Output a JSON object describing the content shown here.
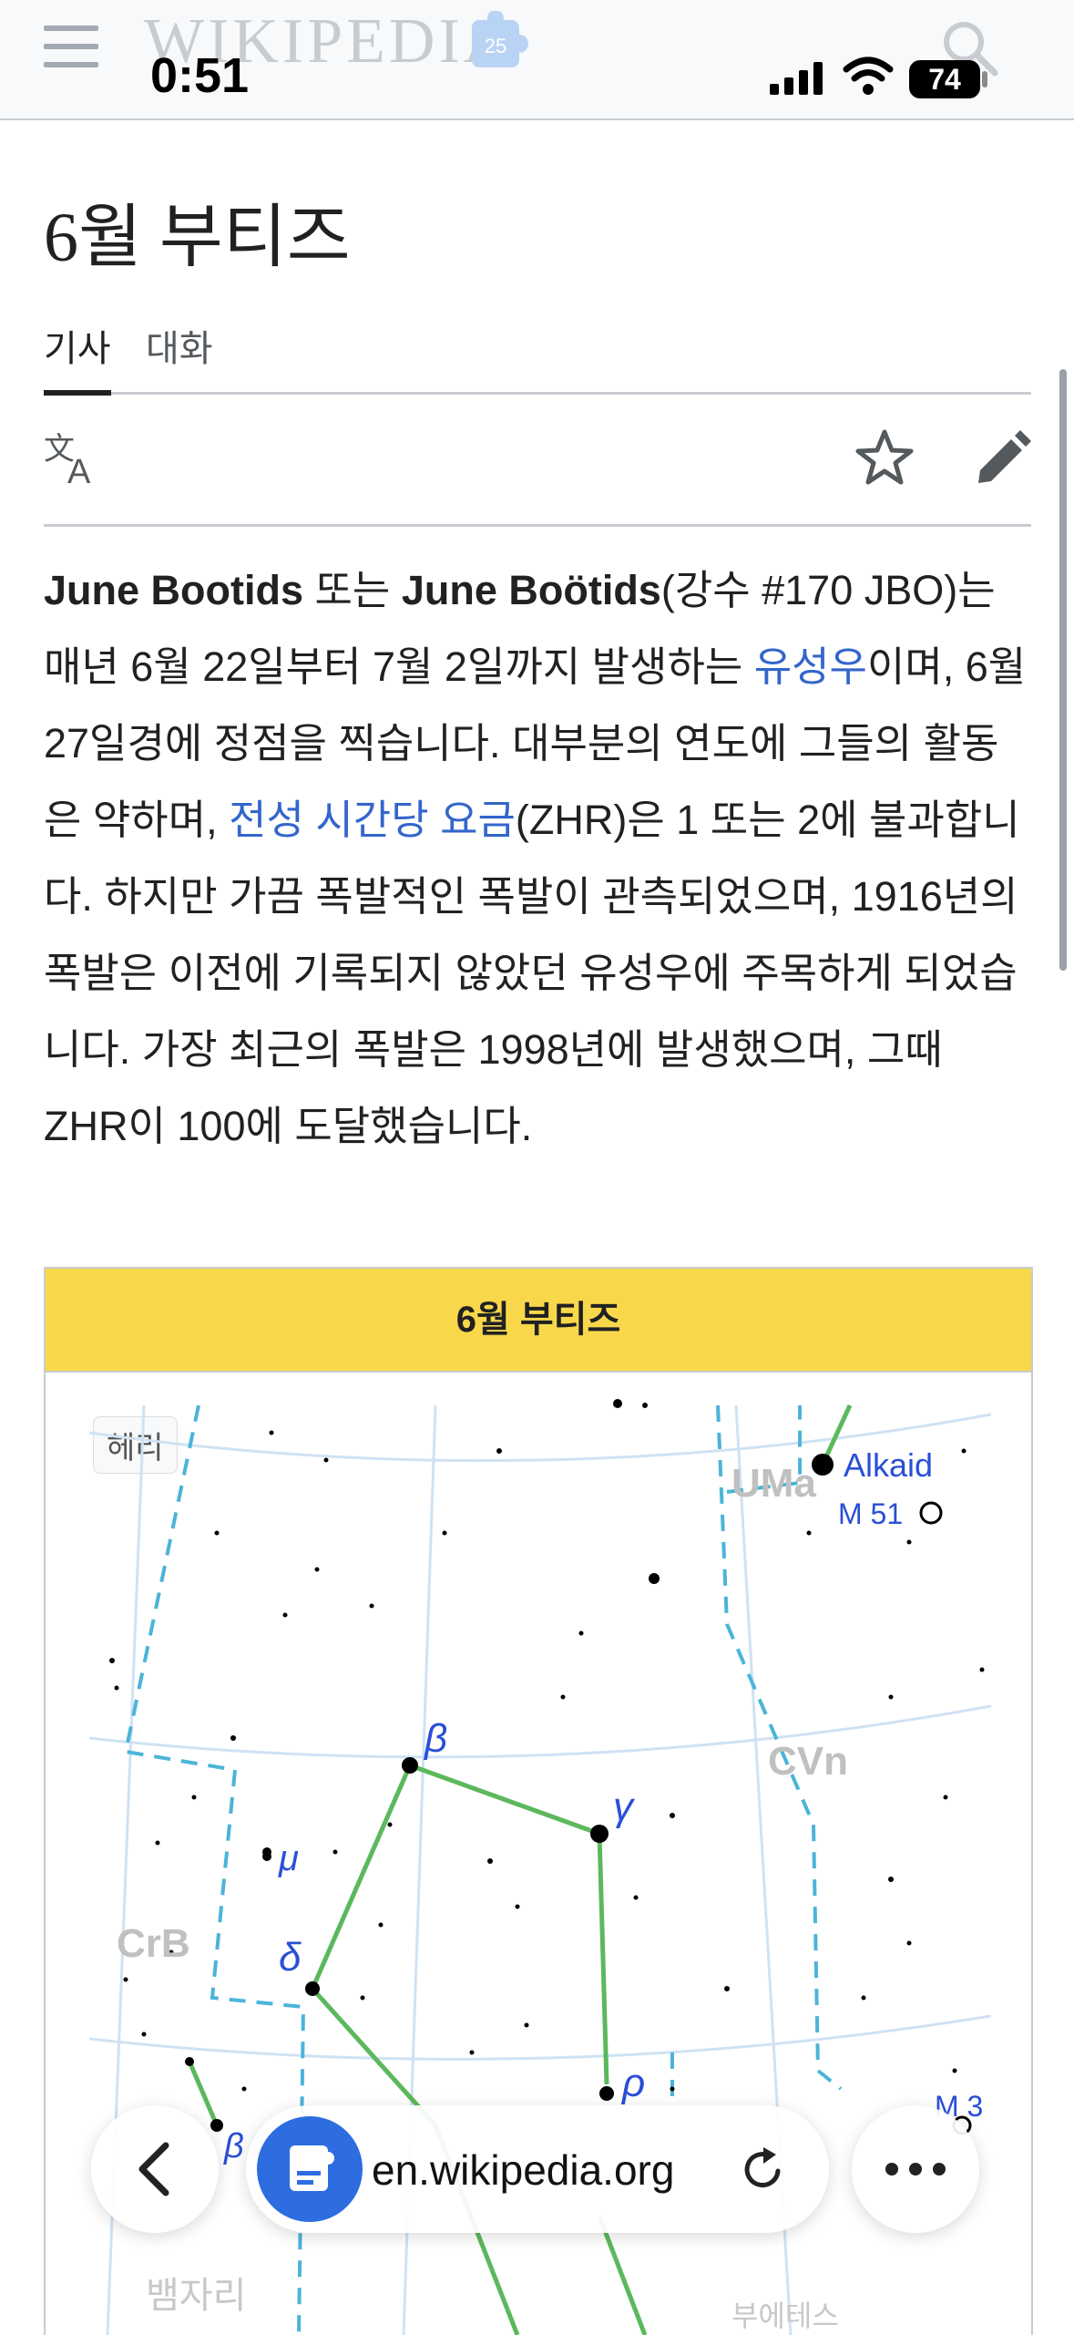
{
  "header": {
    "wordmark": "WIKIPEDIA",
    "anniversary_badge": "25"
  },
  "status_bar": {
    "time": "0:51",
    "battery": "74"
  },
  "page": {
    "title": "6월 부티즈"
  },
  "tabs": [
    {
      "label": "기사"
    },
    {
      "label": "대화"
    }
  ],
  "toolbar": {
    "translate_icon": "translate-icon",
    "watch_icon": "star-icon",
    "edit_icon": "pencil-icon"
  },
  "body": {
    "s1_b1": "June Bootids",
    "s1_t1": " 또는 ",
    "s1_b2": "June Boötids",
    "s1_t2": "(강수 #170 JBO)는 매년 6월 22일부터 7월 2일까지 발생하는 ",
    "s1_link": "유성우",
    "s1_t3": "이며, 6월 27일경에 정점을 찍습니다. 대부분의 연도에 그들의 활동은 약하며, ",
    "s2_link": "전성 시간당 요금",
    "s2_t1": "(ZHR)은 1 또는 2에 불과합니다. 하지만 가끔 폭발적인 폭발이 관측되었으며, 1916년의 폭발은 이전에 기록되지 않았던 유성우에 주목하게 되었습니다. 가장 최근의 폭발은 1998년에 발생했으며, 그때 ZHR이 100에 도달했습니다."
  },
  "infobox": {
    "title": "6월 부티즈",
    "map_badge": "헤리",
    "map_labels": {
      "uma": "UMa",
      "alkaid": "Alkaid",
      "m51": "M 51",
      "cvn": "CVn",
      "crb": "CrB",
      "m3": "M 3",
      "beta": "β",
      "gamma": "γ",
      "delta": "δ",
      "mu": "μ",
      "rho": "ρ",
      "beta2": "β",
      "bottom_left": "뱀자리",
      "bottom_right": "부에테스"
    }
  },
  "browser": {
    "url": "en.wikipedia.org"
  },
  "colors": {
    "link": "#3366cc",
    "infobox_header": "#f8d84a",
    "constellation_line": "#5cb85c",
    "boundary": "#4bb4d8"
  }
}
